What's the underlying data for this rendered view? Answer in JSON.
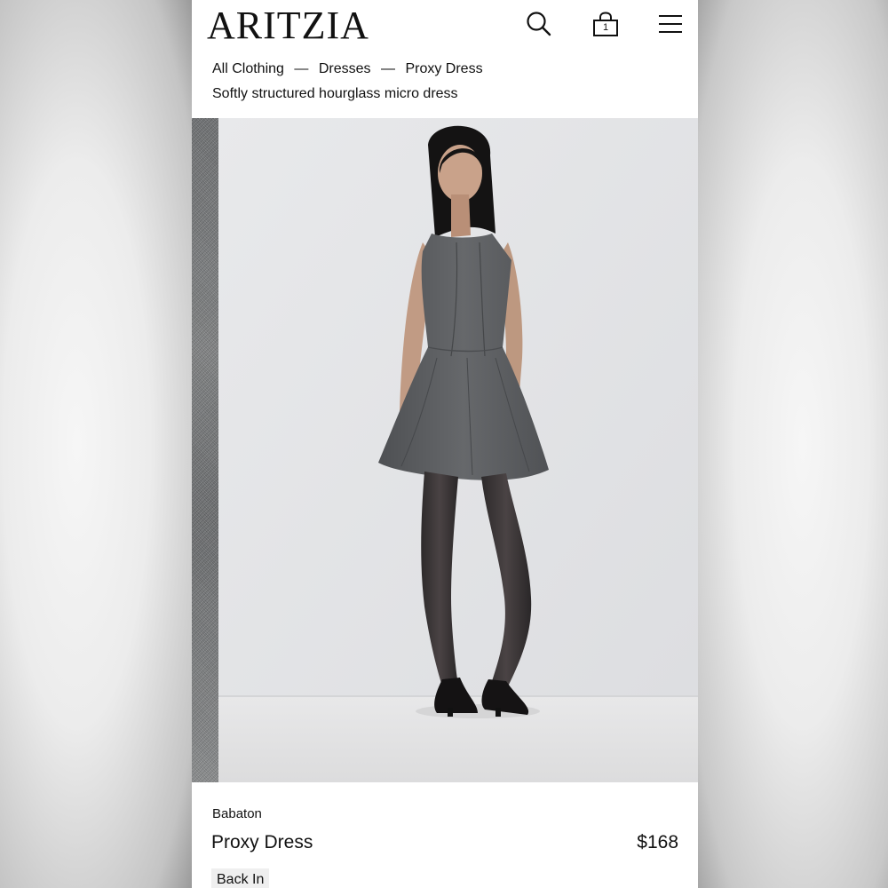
{
  "header": {
    "logo": "ARITZIA",
    "icons": [
      "search-icon",
      "bag-icon",
      "menu-icon"
    ],
    "bag_count": "1"
  },
  "breadcrumb": {
    "items": [
      "All Clothing",
      "Dresses",
      "Proxy Dress"
    ],
    "separator": "—"
  },
  "tagline": "Softly structured hourglass micro dress",
  "product": {
    "brand": "Babaton",
    "name": "Proxy Dress",
    "price": "$168",
    "badge": "Back In"
  },
  "colors": {
    "background": "#ffffff",
    "text": "#111111",
    "badge_bg": "#efefef",
    "studio_backdrop": "#e6e7e9",
    "dress_gray": "#5d5f62"
  }
}
